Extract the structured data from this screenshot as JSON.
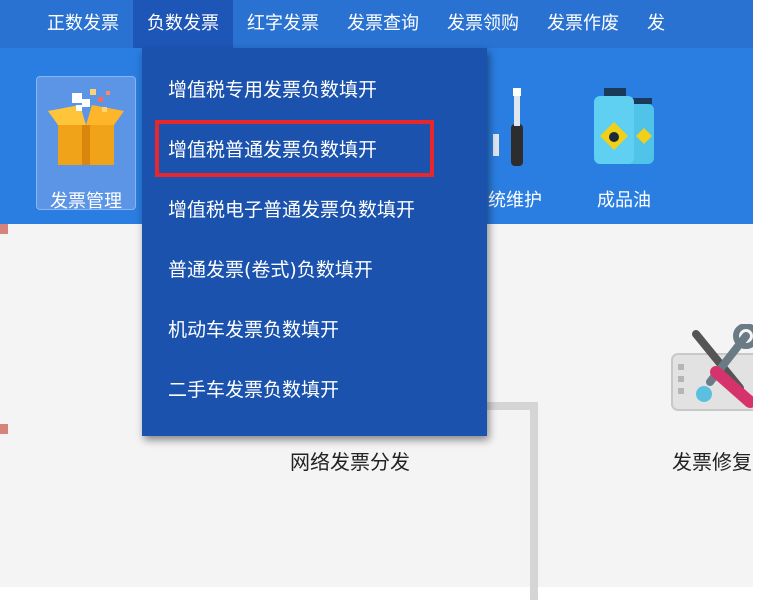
{
  "menubar": {
    "items": [
      {
        "label": "正数发票",
        "active": false
      },
      {
        "label": "负数发票",
        "active": true
      },
      {
        "label": "红字发票",
        "active": false
      },
      {
        "label": "发票查询",
        "active": false
      },
      {
        "label": "发票领购",
        "active": false
      },
      {
        "label": "发票作废",
        "active": false
      },
      {
        "label": "发",
        "active": false
      }
    ]
  },
  "toolbar": {
    "tools": [
      {
        "label": "发票管理",
        "icon": "open-box-icon",
        "active": true
      },
      {
        "label": "统维护",
        "icon": "tools-icon",
        "active": false
      },
      {
        "label": "成品油",
        "icon": "oil-can-icon",
        "active": false
      }
    ]
  },
  "dropdown": {
    "items": [
      {
        "label": "增值税专用发票负数填开"
      },
      {
        "label": "增值税普通发票负数填开",
        "highlighted": true
      },
      {
        "label": "增值税电子普通发票负数填开"
      },
      {
        "label": "普通发票(卷式)负数填开"
      },
      {
        "label": "机动车发票负数填开"
      },
      {
        "label": "二手车发票负数填开"
      }
    ]
  },
  "content": {
    "network_distribution_label": "网络发票分发",
    "invoice_repair_label": "发票修复"
  },
  "colors": {
    "menubar_bg": "#2a72d2",
    "toolbar_bg": "#2a7de1",
    "dropdown_bg": "#1a52ad",
    "highlight_border": "#e8262e"
  }
}
